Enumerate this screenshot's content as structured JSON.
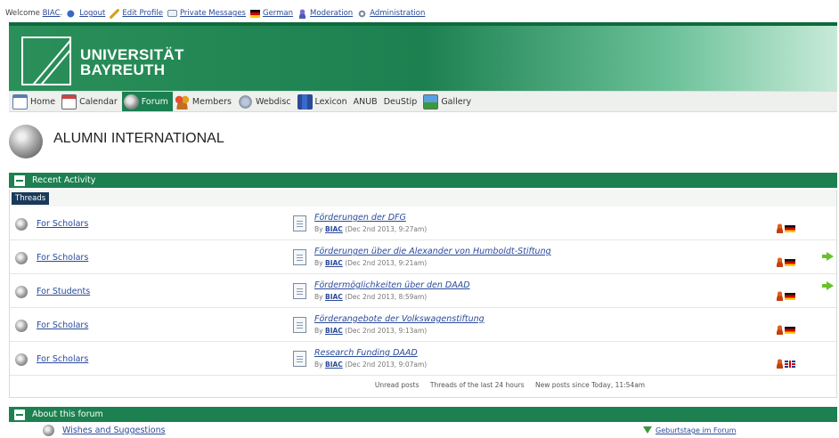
{
  "userbar": {
    "welcome_prefix": "Welcome",
    "username": "BIAC",
    "items": [
      "Logout",
      "Edit Profile",
      "Private Messages",
      "German",
      "Moderation",
      "Administration"
    ]
  },
  "banner": {
    "logo_line1": "UNIVERSITÄT",
    "logo_line2": "BAYREUTH"
  },
  "nav": {
    "items": [
      "Home",
      "Calendar",
      "Forum",
      "Members",
      "Webdisc",
      "Lexicon",
      "ANUB",
      "DeuStip",
      "Gallery"
    ],
    "active": "Forum"
  },
  "page": {
    "title": "ALUMNI INTERNATIONAL"
  },
  "recent": {
    "title": "Recent Activity",
    "tab": "Threads",
    "rows": [
      {
        "forum": "For Scholars",
        "thread": "Förderungen der DFG",
        "by": "By",
        "user": "BIAC",
        "date": "(Dec 2nd 2013, 9:27am)",
        "flag": "de",
        "arrow": false
      },
      {
        "forum": "For Scholars",
        "thread": "Förderungen über die Alexander von Humboldt-Stiftung",
        "by": "By",
        "user": "BIAC",
        "date": "(Dec 2nd 2013, 9:21am)",
        "flag": "de",
        "arrow": true
      },
      {
        "forum": "For Students",
        "thread": "Fördermöglichkeiten über den DAAD",
        "by": "By",
        "user": "BIAC",
        "date": "(Dec 2nd 2013, 8:59am)",
        "flag": "de",
        "arrow": true
      },
      {
        "forum": "For Scholars",
        "thread": "Förderangebote der Volkswagenstiftung",
        "by": "By",
        "user": "BIAC",
        "date": "(Dec 2nd 2013, 9:13am)",
        "flag": "de",
        "arrow": false
      },
      {
        "forum": "For Scholars",
        "thread": "Research Funding DAAD",
        "by": "By",
        "user": "BIAC",
        "date": "(Dec 2nd 2013, 9:07am)",
        "flag": "uk",
        "arrow": false
      }
    ],
    "footer": [
      "Unread posts",
      "Threads of the last 24 hours",
      "New posts since Today, 11:54am"
    ]
  },
  "about": {
    "title": "About this forum",
    "link": "Wishes and Suggestions",
    "right_link": "Geburtstage im Forum"
  },
  "colors": {
    "brand_green": "#1c8050",
    "link_blue": "#2a4a9a"
  }
}
